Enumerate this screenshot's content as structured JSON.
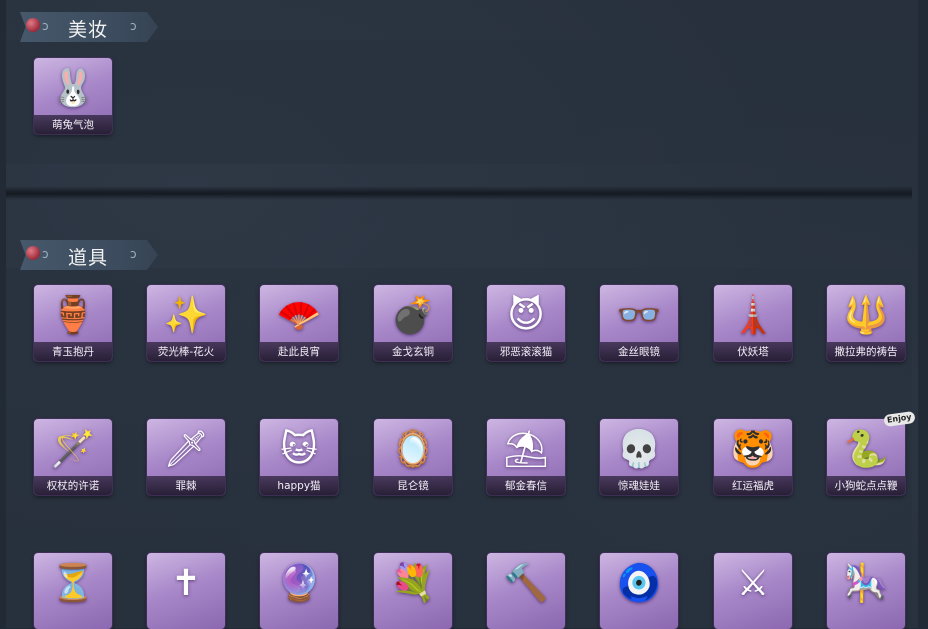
{
  "sections": {
    "makeup": {
      "title": "美妆",
      "items": [
        {
          "name": "萌兔气泡",
          "icon": "bunny-bubble-icon",
          "glyph": "🐰"
        }
      ]
    },
    "props": {
      "title": "道具",
      "rows": [
        [
          {
            "name": "青玉抱丹",
            "icon": "jade-vase-icon",
            "glyph": "🏺"
          },
          {
            "name": "荧光棒-花火",
            "icon": "sparkler-icon",
            "glyph": "✨"
          },
          {
            "name": "赴此良宵",
            "icon": "fan-icon",
            "glyph": "🪭"
          },
          {
            "name": "金戈玄铜",
            "icon": "bronze-grenade-icon",
            "glyph": "💣"
          },
          {
            "name": "邪恶滚滚猫",
            "icon": "evil-cat-icon",
            "glyph": "😈"
          },
          {
            "name": "金丝眼镜",
            "icon": "glasses-icon",
            "glyph": "👓"
          },
          {
            "name": "伏妖塔",
            "icon": "pagoda-icon",
            "glyph": "🗼"
          },
          {
            "name": "撒拉弗的祷告",
            "icon": "trident-icon",
            "glyph": "🔱"
          }
        ],
        [
          {
            "name": "权杖的许诺",
            "icon": "scepter-icon",
            "glyph": "🪄"
          },
          {
            "name": "罪棘",
            "icon": "spear-icon",
            "glyph": "🗡"
          },
          {
            "name": "happy猫",
            "icon": "happy-cat-icon",
            "glyph": "🐱"
          },
          {
            "name": "昆仑镜",
            "icon": "mirror-icon",
            "glyph": "🪞"
          },
          {
            "name": "郁金春信",
            "icon": "umbrella-icon",
            "glyph": "⛱"
          },
          {
            "name": "惊魂娃娃",
            "icon": "skull-doll-icon",
            "glyph": "💀"
          },
          {
            "name": "红运福虎",
            "icon": "lucky-tiger-icon",
            "glyph": "🐯"
          },
          {
            "name": "小狗蛇点点鞭",
            "icon": "snake-dog-icon",
            "glyph": "🐍"
          }
        ],
        [
          {
            "name": "",
            "icon": "hourglass-icon",
            "glyph": "⏳"
          },
          {
            "name": "",
            "icon": "golden-cross-icon",
            "glyph": "✝"
          },
          {
            "name": "",
            "icon": "crystal-spear-icon",
            "glyph": "🔮"
          },
          {
            "name": "",
            "icon": "flower-bouquet-icon",
            "glyph": "💐"
          },
          {
            "name": "",
            "icon": "golden-shovel-icon",
            "glyph": "🔨"
          },
          {
            "name": "",
            "icon": "dreamcatcher-icon",
            "glyph": "🧿"
          },
          {
            "name": "",
            "icon": "curved-blade-icon",
            "glyph": "⚔"
          },
          {
            "name": "",
            "icon": "music-box-icon",
            "glyph": "🎠"
          }
        ]
      ]
    }
  },
  "badges": {
    "enjoy": "Enjoy"
  },
  "colors": {
    "background": "#27303c",
    "item_purple": "#a888c9",
    "header_band": "#46586b"
  }
}
